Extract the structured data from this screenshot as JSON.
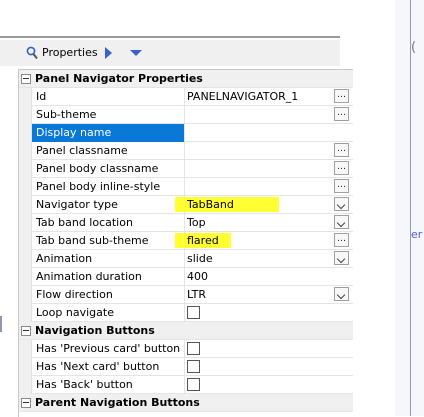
{
  "toolbar": {
    "title": "Properties",
    "icon": "search-icon"
  },
  "groups": [
    {
      "label": "Panel Navigator Properties",
      "rows": [
        {
          "name": "Id",
          "value": "PANELNAVIGATOR_1",
          "editor": "dots"
        },
        {
          "name": "Sub-theme",
          "value": "",
          "editor": "dots"
        },
        {
          "name": "Display name",
          "value": "",
          "editor": "none",
          "selected": true
        },
        {
          "name": "Panel classname",
          "value": "",
          "editor": "dots"
        },
        {
          "name": "Panel body classname",
          "value": "",
          "editor": "dots"
        },
        {
          "name": "Panel body inline-style",
          "value": "",
          "editor": "dots"
        },
        {
          "name": "Navigator type",
          "value": "TabBand",
          "editor": "dropdown",
          "highlighted": true
        },
        {
          "name": "Tab band location",
          "value": "Top",
          "editor": "dropdown"
        },
        {
          "name": "Tab band sub-theme",
          "value": "flared",
          "editor": "dots",
          "highlighted": true
        },
        {
          "name": "Animation",
          "value": "slide",
          "editor": "dropdown"
        },
        {
          "name": "Animation duration",
          "value": "400",
          "editor": "none"
        },
        {
          "name": "Flow direction",
          "value": "LTR",
          "editor": "dropdown"
        },
        {
          "name": "Loop navigate",
          "value": false,
          "editor": "checkbox"
        }
      ]
    },
    {
      "label": "Navigation Buttons",
      "rows": [
        {
          "name": "Has 'Previous card' button",
          "value": false,
          "editor": "checkbox"
        },
        {
          "name": "Has 'Next card' button",
          "value": false,
          "editor": "checkbox"
        },
        {
          "name": "Has 'Back' button",
          "value": false,
          "editor": "checkbox"
        }
      ]
    },
    {
      "label": "Parent Navigation Buttons",
      "rows": []
    }
  ],
  "right_panel": {
    "paren_text": "(",
    "text_fragment": "er"
  },
  "colors": {
    "selection": "#0a78d7",
    "highlight": "#ffff33",
    "toolbar_icon": "#3a5fd0"
  }
}
